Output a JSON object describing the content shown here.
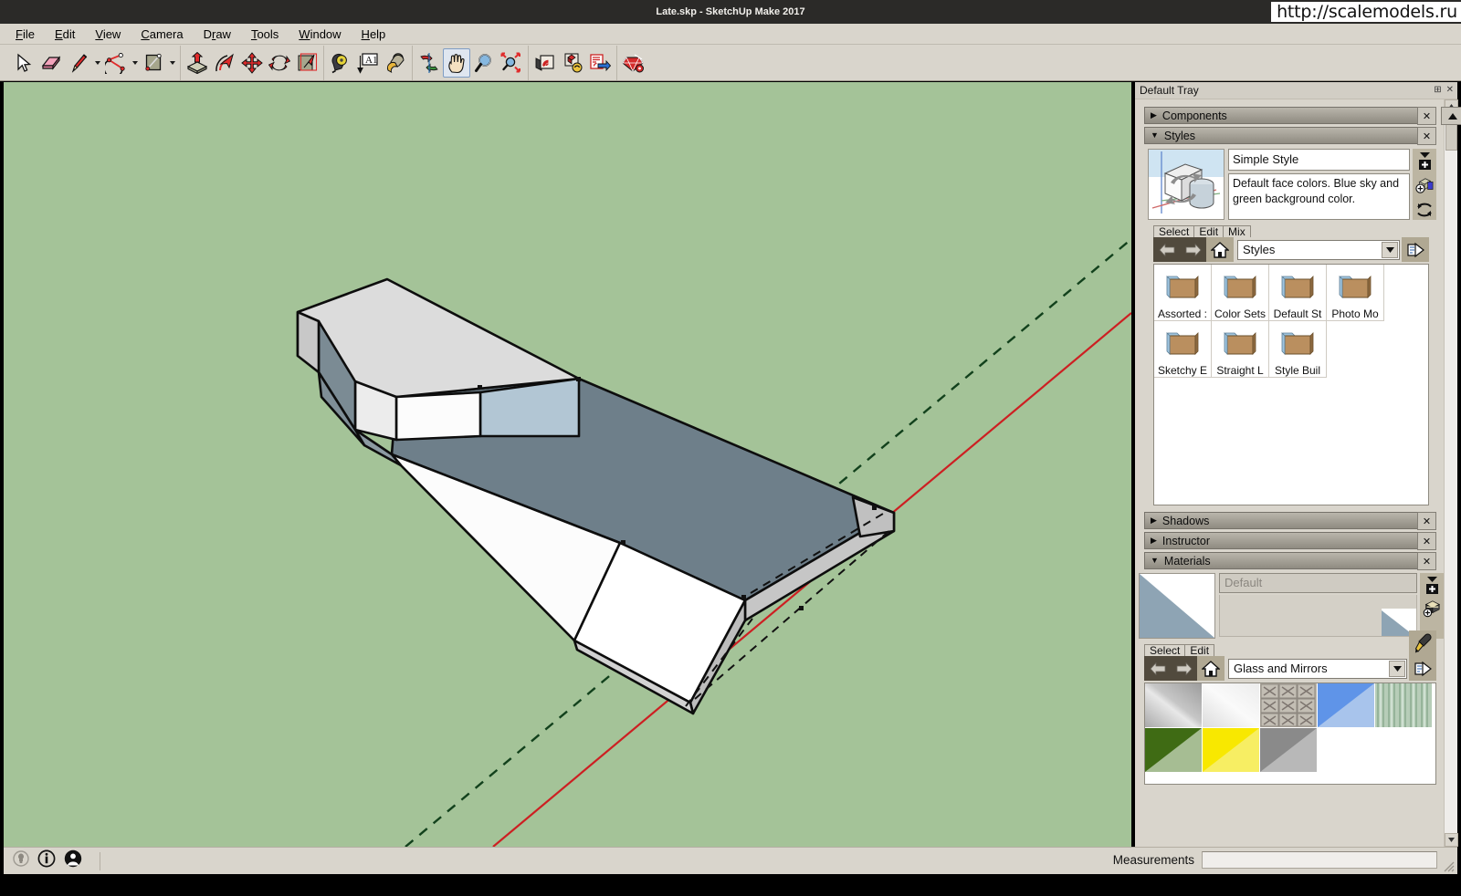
{
  "window": {
    "title": "Late.skp - SketchUp Make 2017",
    "watermark": "http://scalemodels.ru"
  },
  "menubar": {
    "items": [
      {
        "label": "File",
        "mnemonic": "F"
      },
      {
        "label": "Edit",
        "mnemonic": "E"
      },
      {
        "label": "View",
        "mnemonic": "V"
      },
      {
        "label": "Camera",
        "mnemonic": "C"
      },
      {
        "label": "Draw",
        "mnemonic": "D"
      },
      {
        "label": "Tools",
        "mnemonic": "T"
      },
      {
        "label": "Window",
        "mnemonic": "W"
      },
      {
        "label": "Help",
        "mnemonic": "H"
      }
    ]
  },
  "toolbar": {
    "groups": [
      {
        "tools": [
          {
            "name": "select-tool",
            "icon": "arrow-cursor-icon",
            "label": "Select",
            "active": false,
            "caret": false
          },
          {
            "name": "eraser-tool",
            "icon": "eraser-icon",
            "label": "Eraser",
            "active": false,
            "caret": false
          },
          {
            "name": "line-tool",
            "icon": "pencil-icon",
            "label": "Line",
            "active": false,
            "caret": true
          },
          {
            "name": "arc-tool",
            "icon": "arc-icon",
            "label": "Arc",
            "active": false,
            "caret": true
          },
          {
            "name": "rectangle-tool",
            "icon": "rectangle-icon",
            "label": "Rectangle",
            "active": false,
            "caret": true
          }
        ]
      },
      {
        "tools": [
          {
            "name": "pushpull-tool",
            "icon": "push-pull-icon",
            "label": "Push/Pull",
            "active": false,
            "caret": false
          },
          {
            "name": "followme-tool",
            "icon": "follow-me-icon",
            "label": "Follow Me",
            "active": false,
            "caret": false
          },
          {
            "name": "move-tool",
            "icon": "move-arrows-icon",
            "label": "Move",
            "active": false,
            "caret": false
          },
          {
            "name": "rotate-tool",
            "icon": "rotate-icon",
            "label": "Rotate",
            "active": false,
            "caret": false
          },
          {
            "name": "scale-tool",
            "icon": "scale-icon",
            "label": "Scale",
            "active": false,
            "caret": false
          }
        ]
      },
      {
        "tools": [
          {
            "name": "tape-measure-tool",
            "icon": "tape-measure-icon",
            "label": "Tape Measure",
            "active": false,
            "caret": false
          },
          {
            "name": "dimension-tool",
            "icon": "dimension-a1-icon",
            "label": "Dimension",
            "active": false,
            "caret": false
          },
          {
            "name": "paint-bucket-tool",
            "icon": "paint-bucket-icon",
            "label": "Paint Bucket",
            "active": false,
            "caret": false
          }
        ]
      },
      {
        "tools": [
          {
            "name": "orbit-tool",
            "icon": "orbit-icon",
            "label": "Orbit",
            "active": false,
            "caret": false
          },
          {
            "name": "pan-tool",
            "icon": "hand-pan-icon",
            "label": "Pan",
            "active": true,
            "caret": false
          },
          {
            "name": "zoom-tool",
            "icon": "magnifier-icon",
            "label": "Zoom",
            "active": false,
            "caret": false
          },
          {
            "name": "zoom-extents-tool",
            "icon": "zoom-extents-icon",
            "label": "Zoom Extents",
            "active": false,
            "caret": false
          }
        ]
      },
      {
        "tools": [
          {
            "name": "warehouse-models-button",
            "icon": "warehouse-models-icon",
            "label": "3D Warehouse",
            "active": false,
            "caret": false
          },
          {
            "name": "warehouse-share-button",
            "icon": "warehouse-share-icon",
            "label": "Share Model",
            "active": false,
            "caret": false
          },
          {
            "name": "extension-warehouse-button",
            "icon": "extension-warehouse-icon",
            "label": "Extension Warehouse",
            "active": false,
            "caret": false
          }
        ]
      },
      {
        "tools": [
          {
            "name": "extension-manager-button",
            "icon": "ruby-gear-icon",
            "label": "Extension Manager",
            "active": false,
            "caret": false
          }
        ]
      }
    ]
  },
  "viewport": {
    "background_color": "#a4c398",
    "axis_green_color": "#12411c",
    "axis_red_color": "#cd1f22",
    "model_name": "boat-hull-model",
    "face_colors": {
      "front_light": "#dcdcdc",
      "front_white": "#fdfdfd",
      "back_slate": "#6e7f8a",
      "back_slate_dark": "#64757f",
      "glass_blue": "#b2c6d4",
      "side_grey": "#bfbfbf",
      "edge": "#0d0d0d"
    }
  },
  "tray": {
    "title": "Default Tray",
    "pin_icon": "pin-icon",
    "close_icon": "close-icon",
    "sections": [
      {
        "name": "components",
        "label": "Components",
        "expanded": false,
        "close": "×"
      },
      {
        "name": "styles",
        "label": "Styles",
        "expanded": true,
        "close": "×"
      },
      {
        "name": "shadows",
        "label": "Shadows",
        "expanded": false,
        "close": "×"
      },
      {
        "name": "instructor",
        "label": "Instructor",
        "expanded": false,
        "close": "×"
      },
      {
        "name": "materials",
        "label": "Materials",
        "expanded": true,
        "close": "×"
      }
    ]
  },
  "styles_panel": {
    "style_name": "Simple Style",
    "style_description": "Default face colors. Blue sky and green background color.",
    "thumbnail_icon": "style-preview-icon",
    "side_buttons": [
      {
        "name": "create-new-style-button",
        "icon": "add-style-icon"
      },
      {
        "name": "update-style-button",
        "icon": "update-style-icon"
      },
      {
        "name": "refresh-style-button",
        "icon": "refresh-icon"
      }
    ],
    "tabs": [
      {
        "name": "tab-select",
        "label": "Select",
        "selected": true
      },
      {
        "name": "tab-edit",
        "label": "Edit",
        "selected": false
      },
      {
        "name": "tab-mix",
        "label": "Mix",
        "selected": false
      }
    ],
    "nav": {
      "back_icon": "arrow-left-icon",
      "forward_icon": "arrow-right-icon",
      "home_icon": "home-icon",
      "collection": "Styles",
      "dropdown_icon": "chevron-down-icon",
      "detail_icon": "details-flyout-icon"
    },
    "folders": [
      {
        "name": "folder-assorted-styles",
        "label": "Assorted :"
      },
      {
        "name": "folder-color-sets",
        "label": "Color Sets"
      },
      {
        "name": "folder-default-styles",
        "label": "Default St"
      },
      {
        "name": "folder-photo-modeling",
        "label": "Photo Mo"
      },
      {
        "name": "folder-sketchy-edges",
        "label": "Sketchy E"
      },
      {
        "name": "folder-straight-lines",
        "label": "Straight L"
      },
      {
        "name": "folder-style-builder",
        "label": "Style Buil"
      }
    ]
  },
  "materials_panel": {
    "material_name_placeholder": "Default",
    "thumbnail_name": "default-material-swatch",
    "side_buttons": [
      {
        "name": "create-material-button",
        "icon": "add-material-icon"
      },
      {
        "name": "edit-material-list-button",
        "icon": "material-stack-icon"
      }
    ],
    "tabs": [
      {
        "name": "tab-select",
        "label": "Select",
        "selected": true
      },
      {
        "name": "tab-edit",
        "label": "Edit",
        "selected": false
      }
    ],
    "nav": {
      "back_icon": "arrow-left-icon",
      "forward_icon": "arrow-right-icon",
      "home_icon": "home-icon",
      "collection": "Glass and Mirrors",
      "dropdown_icon": "chevron-down-icon",
      "eyedropper_icon": "eyedropper-icon",
      "detail_icon": "details-flyout-icon"
    },
    "swatches": [
      {
        "name": "swatch-mirror",
        "kind": "mirror-gradient"
      },
      {
        "name": "swatch-translucent-glass-white",
        "kind": "white-gradient"
      },
      {
        "name": "swatch-glass-block",
        "kind": "glass-block-texture"
      },
      {
        "name": "swatch-glass-blue",
        "kind": "blue-split"
      },
      {
        "name": "swatch-glass-corrugated-green",
        "kind": "corrugated-green"
      },
      {
        "name": "swatch-glass-dark-green",
        "kind": "dark-green-split"
      },
      {
        "name": "swatch-glass-yellow",
        "kind": "yellow-split"
      },
      {
        "name": "swatch-glass-grey",
        "kind": "grey-split"
      }
    ]
  },
  "statusbar": {
    "icons": [
      {
        "name": "hint-bulb-icon",
        "glyph": "bulb"
      },
      {
        "name": "info-circle-icon",
        "glyph": "info"
      },
      {
        "name": "account-circle-icon",
        "glyph": "person"
      }
    ],
    "measurements_label": "Measurements",
    "measurements_value": "",
    "resize_handle": "resize-grip-icon"
  }
}
